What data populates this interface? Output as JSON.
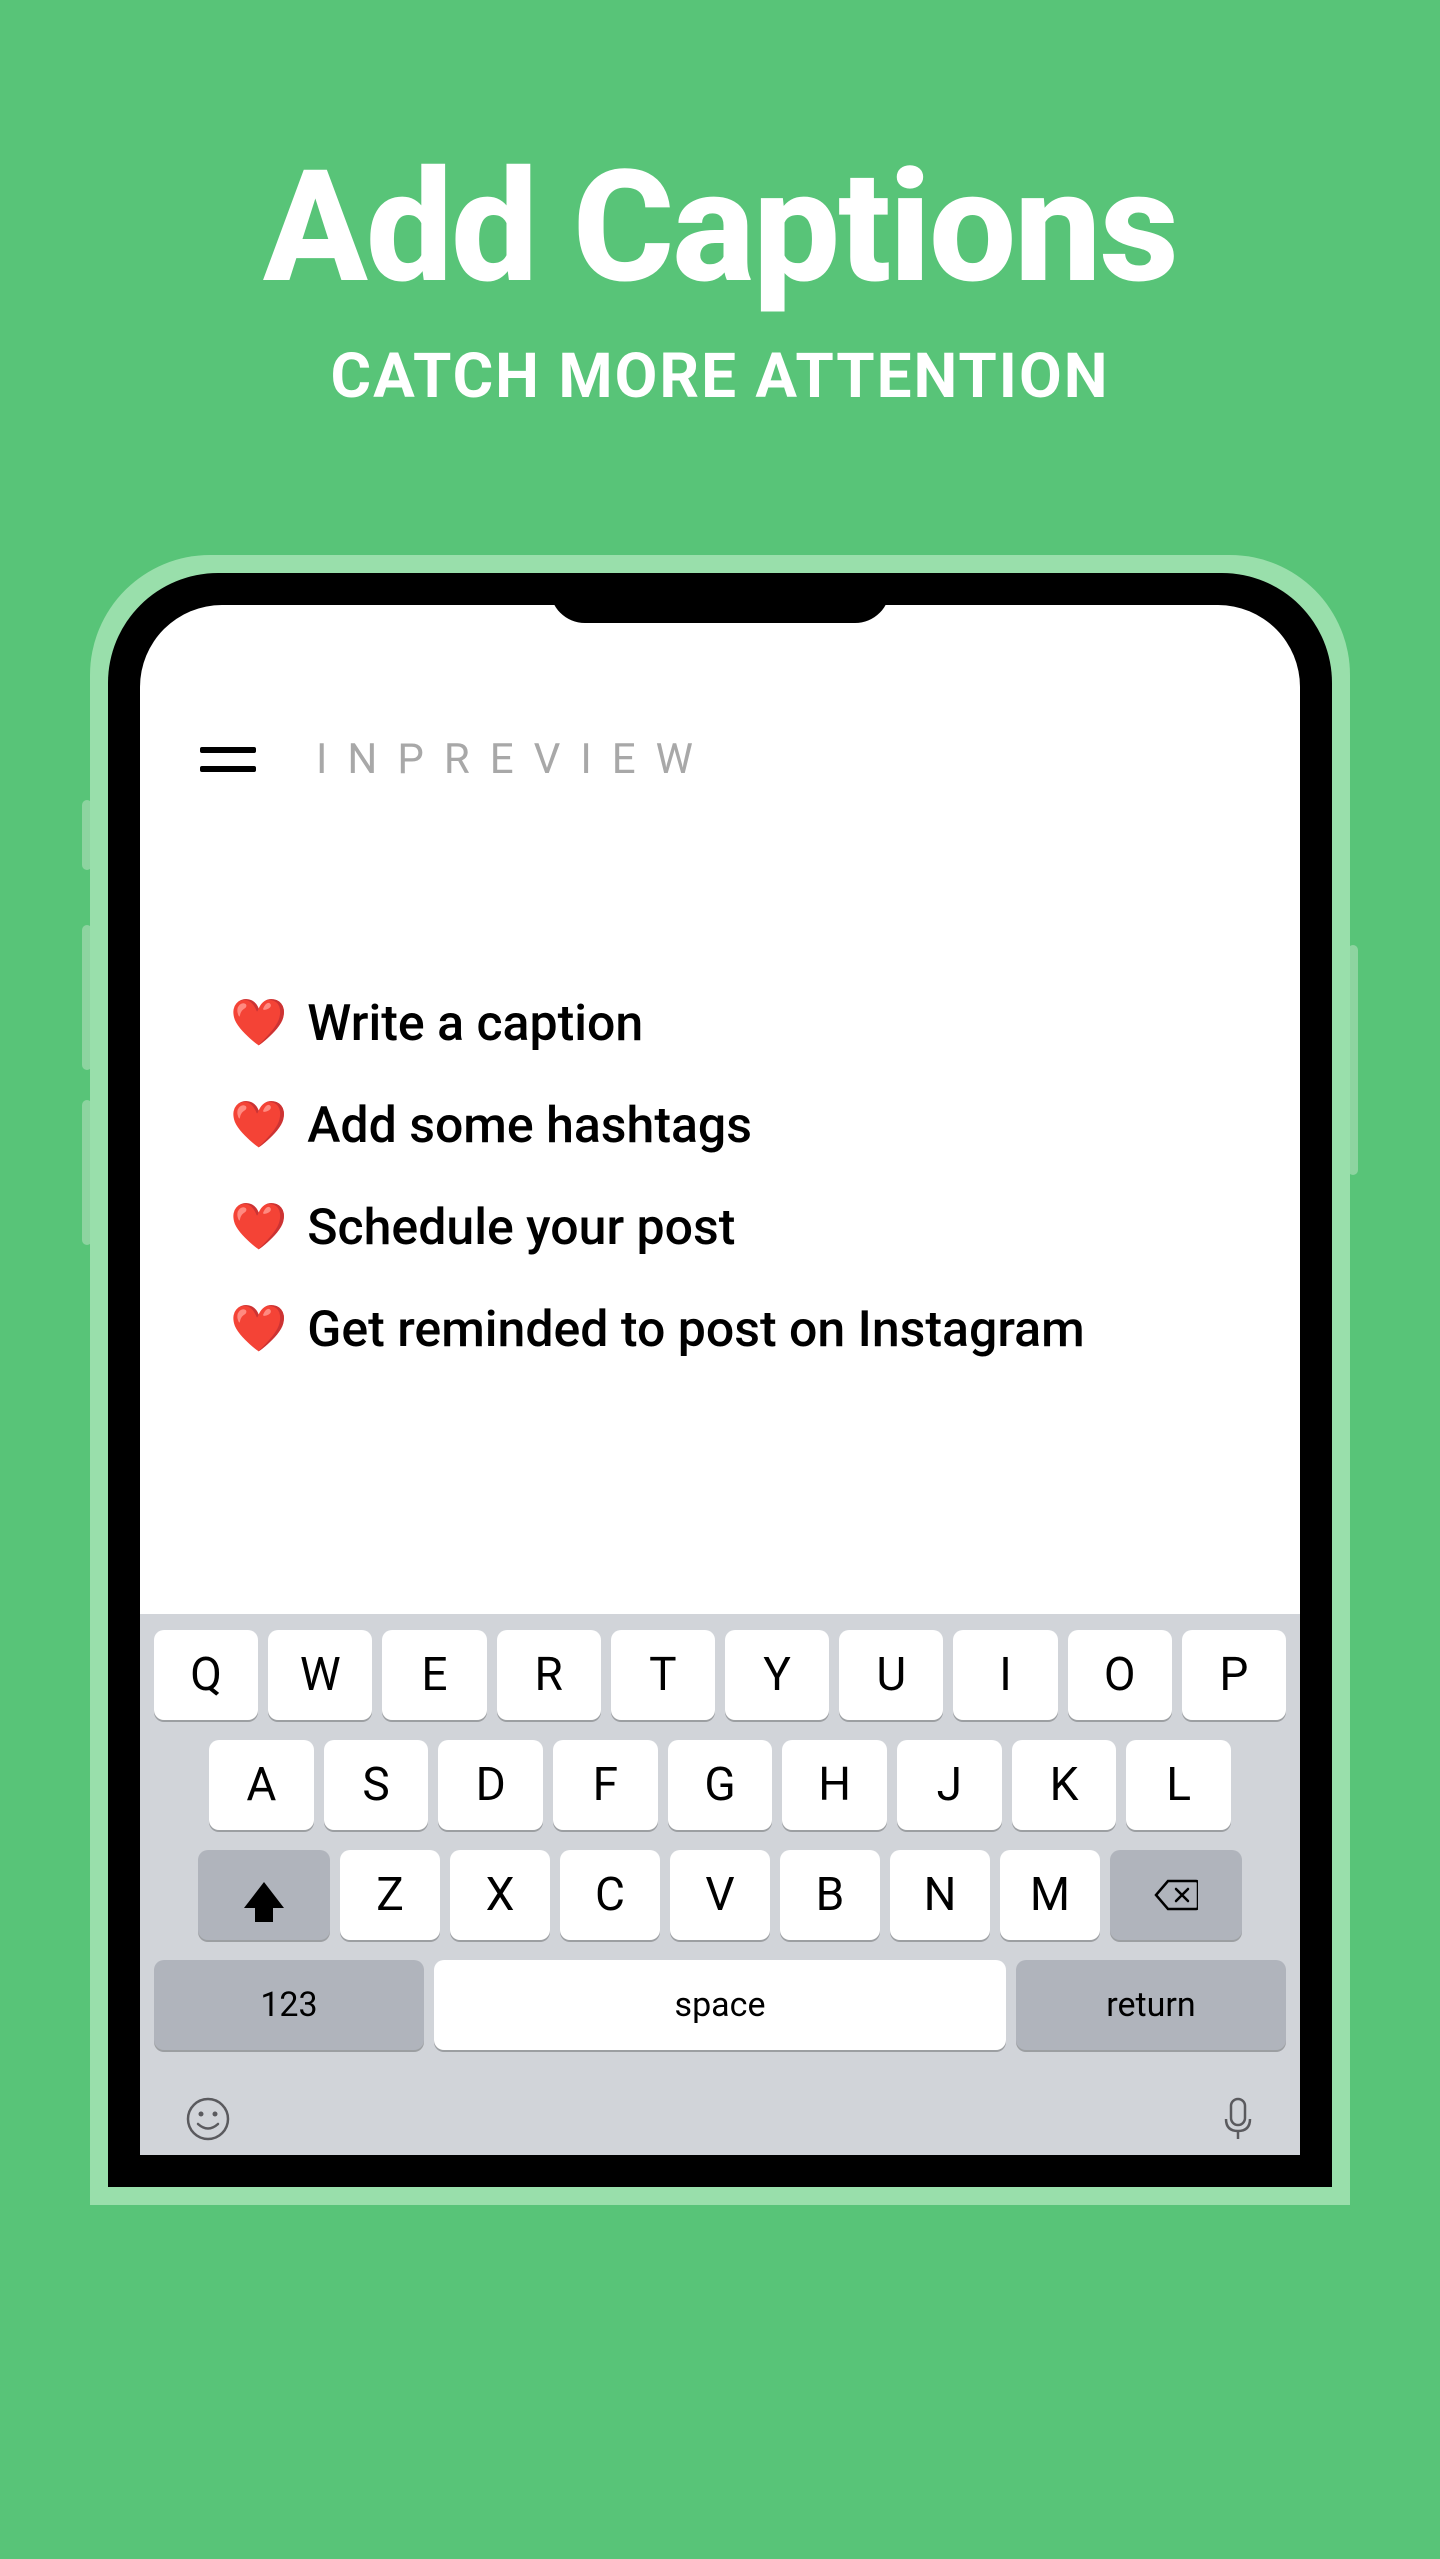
{
  "hero": {
    "title": "Add Captions",
    "subtitle": "CATCH MORE ATTENTION"
  },
  "app": {
    "logo": "INPREVIEW",
    "captions": [
      "Write a caption",
      "Add some hashtags",
      "Schedule your post",
      "Get reminded to post on Instagram"
    ]
  },
  "keyboard": {
    "row1": [
      "Q",
      "W",
      "E",
      "R",
      "T",
      "Y",
      "U",
      "I",
      "O",
      "P"
    ],
    "row2": [
      "A",
      "S",
      "D",
      "F",
      "G",
      "H",
      "J",
      "K",
      "L"
    ],
    "row3": [
      "Z",
      "X",
      "C",
      "V",
      "B",
      "N",
      "M"
    ],
    "numbers": "123",
    "space": "space",
    "return": "return"
  }
}
